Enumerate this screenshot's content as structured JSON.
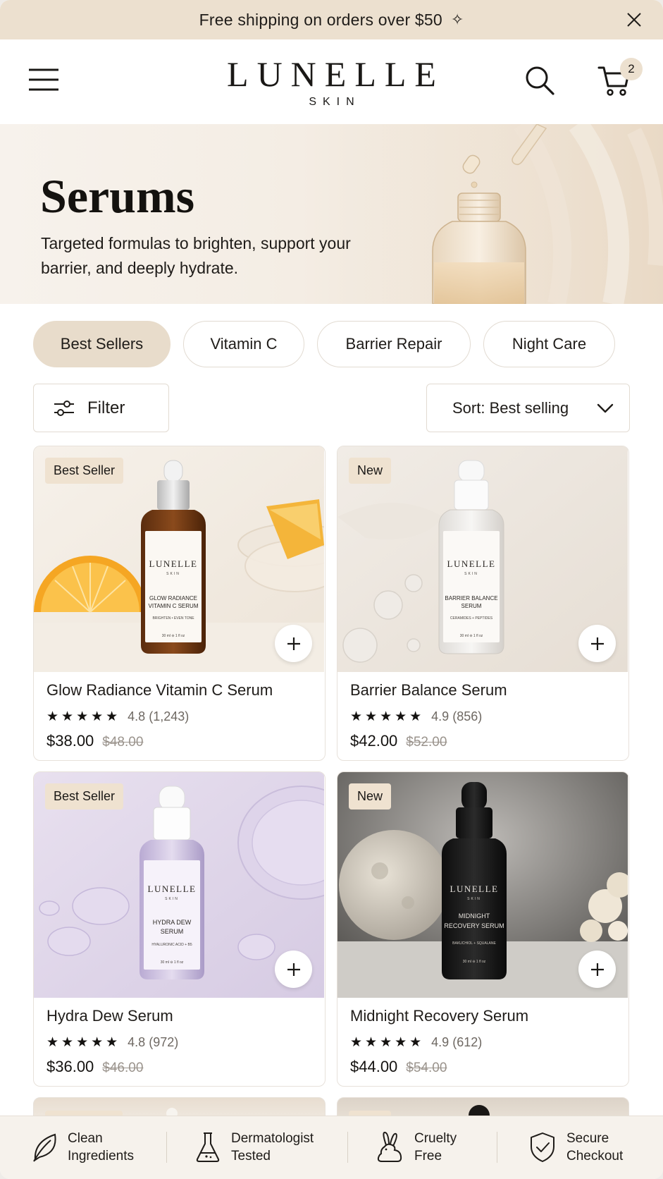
{
  "announcement": {
    "text": "Free shipping on orders over $50",
    "sparkle": "✧"
  },
  "header": {
    "brand": "LUNELLE",
    "brand_sub": "SKIN",
    "cart_count": "2"
  },
  "hero": {
    "title": "Serums",
    "description": "Targeted formulas to brighten, support your barrier, and deeply hydrate."
  },
  "chips": [
    {
      "label": "Best Sellers",
      "active": true
    },
    {
      "label": "Vitamin C",
      "active": false
    },
    {
      "label": "Barrier Repair",
      "active": false
    },
    {
      "label": "Night Care",
      "active": false
    }
  ],
  "toolbar": {
    "filter_label": "Filter",
    "sort_label": "Sort: Best selling"
  },
  "products": [
    {
      "badge": "Best Seller",
      "name": "Glow Radiance Vitamin C Serum",
      "stars": "★★★★★",
      "rating": "4.8 (1,243)",
      "price": "$38.00",
      "was": "$48.00",
      "bottle": {
        "brand": "LUNELLE",
        "sub": "SKIN",
        "line1": "GLOW RADIANCE",
        "line2": "VITAMIN C SERUM",
        "tag": "BRIGHTEN • EVEN TONE",
        "size": "30 ml  ⊖ 1 fl oz"
      }
    },
    {
      "badge": "New",
      "name": "Barrier Balance Serum",
      "stars": "★★★★★",
      "rating": "4.9 (856)",
      "price": "$42.00",
      "was": "$52.00",
      "bottle": {
        "brand": "LUNELLE",
        "sub": "SKIN",
        "line1": "BARRIER BALANCE",
        "line2": "SERUM",
        "tag": "CERAMIDES + PEPTIDES",
        "size": "30 ml  ⊖ 1 fl oz"
      }
    },
    {
      "badge": "Best Seller",
      "name": "Hydra Dew Serum",
      "stars": "★★★★★",
      "rating": "4.8 (972)",
      "price": "$36.00",
      "was": "$46.00",
      "bottle": {
        "brand": "LUNELLE",
        "sub": "SKIN",
        "line1": "HYDRA DEW",
        "line2": "SERUM",
        "tag": "HYALURONIC ACID + B5",
        "size": "30 ml  ⊖ 1 fl oz"
      }
    },
    {
      "badge": "New",
      "name": "Midnight Recovery Serum",
      "stars": "★★★★★",
      "rating": "4.9 (612)",
      "price": "$44.00",
      "was": "$54.00",
      "bottle": {
        "brand": "LUNELLE",
        "sub": "SKIN",
        "line1": "MIDNIGHT",
        "line2": "RECOVERY SERUM",
        "tag": "BAKUCHIOL + SQUALANE",
        "size": "30 ml  ⊖ 1 fl oz"
      }
    }
  ],
  "trust": [
    {
      "line1": "Clean",
      "line2": "Ingredients",
      "icon": "leaf-icon"
    },
    {
      "line1": "Dermatologist",
      "line2": "Tested",
      "icon": "flask-icon"
    },
    {
      "line1": "Cruelty",
      "line2": "Free",
      "icon": "rabbit-icon"
    },
    {
      "line1": "Secure",
      "line2": "Checkout",
      "icon": "shield-check-icon"
    }
  ],
  "colors": {
    "accent": "#e8dccb",
    "announcement_bg": "#ece0cf",
    "text": "#1f1c19",
    "muted": "#9a938c"
  }
}
